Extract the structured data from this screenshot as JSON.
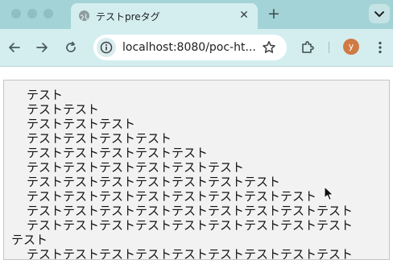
{
  "tab": {
    "title": "テストpreタグ",
    "close_glyph": "✕"
  },
  "new_tab_glyph": "+",
  "toolbar": {
    "url": "localhost:8080/poc-ht..."
  },
  "profile": {
    "initial": "y",
    "color": "#d07a45"
  },
  "pre_lines": [
    "テスト",
    "テストテスト",
    "テストテストテスト",
    "テストテストテストテスト",
    "テストテストテストテストテスト",
    "テストテストテストテストテストテスト",
    "テストテストテストテストテストテストテスト",
    "テストテストテストテストテストテストテストテスト",
    "テストテストテストテストテストテストテストテストテスト",
    "テストテストテストテストテストテストテストテストテスト",
    "テスト",
    "テストテストテストテストテストテストテストテストテスト"
  ],
  "colors": {
    "tab_strip": "#a3d3d6",
    "toolbar": "#d4eef0",
    "pre_background": "#f2f2f2"
  },
  "icons": {
    "back": "arrow-left-icon",
    "forward": "arrow-right-icon",
    "reload": "reload-icon",
    "site_info": "site-info-icon",
    "bookmark": "star-icon",
    "extensions": "puzzle-icon",
    "menu": "kebab-menu-icon",
    "tab_menu": "chevron-down-icon"
  }
}
